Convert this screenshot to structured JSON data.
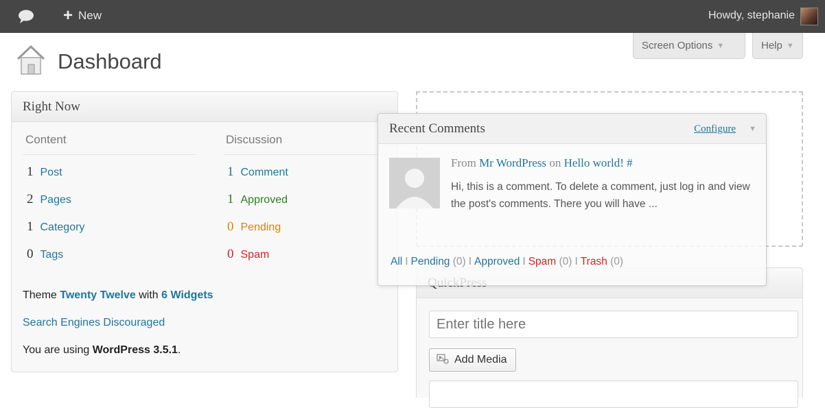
{
  "admin_bar": {
    "new_label": "New",
    "howdy": "Howdy, stephanie"
  },
  "tabs": {
    "screen_options": "Screen Options",
    "help": "Help"
  },
  "page": {
    "title": "Dashboard"
  },
  "right_now": {
    "title": "Right Now",
    "content_heading": "Content",
    "discussion_heading": "Discussion",
    "content_items": [
      {
        "num": "1",
        "label": "Post"
      },
      {
        "num": "2",
        "label": "Pages"
      },
      {
        "num": "1",
        "label": "Category"
      },
      {
        "num": "0",
        "label": "Tags"
      }
    ],
    "discussion_items": [
      {
        "num": "1",
        "label": "Comment"
      },
      {
        "num": "1",
        "label": "Approved"
      },
      {
        "num": "0",
        "label": "Pending"
      },
      {
        "num": "0",
        "label": "Spam"
      }
    ],
    "theme_prefix": "Theme",
    "theme_name": "Twenty Twelve",
    "theme_with": "with",
    "widgets": "6 Widgets",
    "search_engines": "Search Engines Discouraged",
    "using_prefix": "You are using",
    "wp_version": "WordPress 3.5.1",
    "using_suffix": "."
  },
  "recent_comments": {
    "title": "Recent Comments",
    "configure": "Configure",
    "from": "From",
    "author": "Mr WordPress",
    "on": "on",
    "post": "Hello world!",
    "hash": "#",
    "excerpt": "Hi, this is a comment. To delete a comment, just log in and view the post's comments. There you will have ...",
    "links": {
      "all": "All",
      "pending": "Pending",
      "pending_count": "(0)",
      "approved": "Approved",
      "spam": "Spam",
      "spam_count": "(0)",
      "trash": "Trash",
      "trash_count": "(0)",
      "separator": "I"
    }
  },
  "quickpress": {
    "title": "QuickPress",
    "title_placeholder": "Enter title here",
    "add_media": "Add Media"
  },
  "colors": {
    "admin_bar": "#464646",
    "link": "#21759b",
    "approved": "#2d7d20",
    "pending": "#d98500",
    "spam": "#d1232a"
  }
}
